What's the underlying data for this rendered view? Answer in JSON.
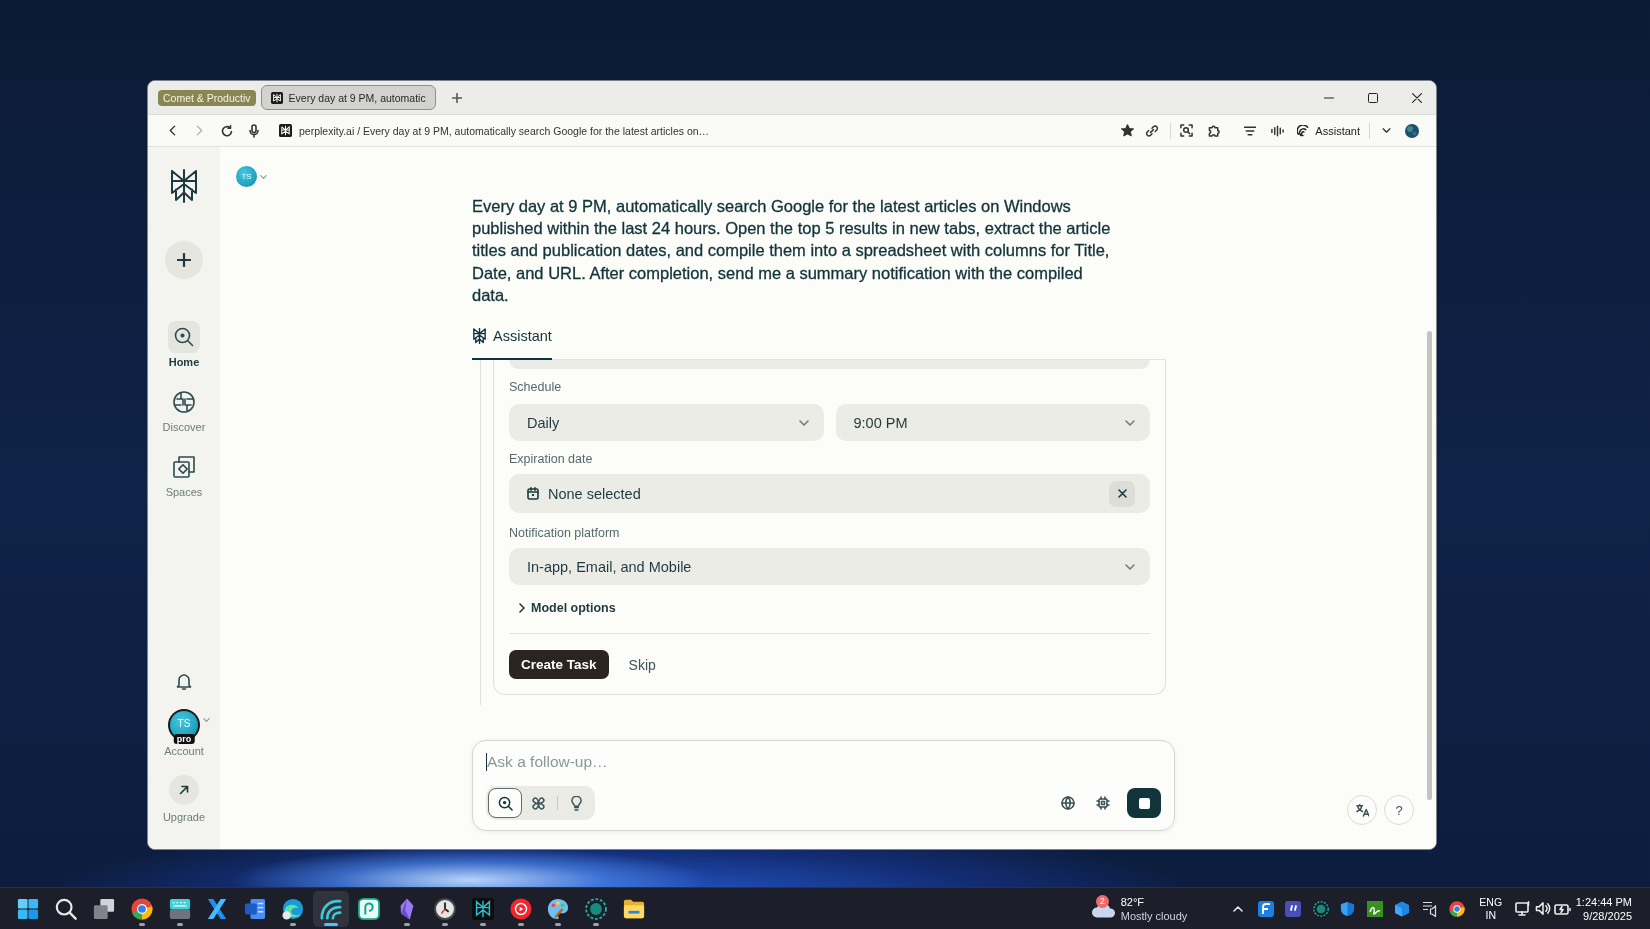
{
  "browser": {
    "tab_group": {
      "label": "Comet & Productiv"
    },
    "tabs": [
      {
        "title": "Every day at 9 PM, automatic",
        "selected": true
      }
    ],
    "address_bar": {
      "back_disabled": false,
      "forward_disabled": true,
      "url": "perplexity.ai / Every day at 9 PM, automatically search Google for the latest articles on…",
      "bookmarked": true,
      "assistant_label": "Assistant"
    }
  },
  "sidebar": {
    "nav": [
      {
        "label": "Home",
        "selected": true
      },
      {
        "label": "Discover",
        "selected": false
      },
      {
        "label": "Spaces",
        "selected": false
      }
    ],
    "account": {
      "initials": "TS",
      "badge": "pro",
      "label": "Account"
    },
    "upgrade": {
      "label": "Upgrade"
    }
  },
  "header": {
    "avatar_initials": "TS"
  },
  "query": "Every day at 9 PM, automatically search Google for the latest articles on Windows published within the last 24 hours. Open the top 5 results in new tabs, extract the article titles and publication dates, and compile them into a spreadsheet with columns for Title, Date, and URL. After completion, send me a summary notification with the compiled data.",
  "answer_tabs": [
    {
      "label": "Assistant",
      "selected": true
    }
  ],
  "task_form": {
    "schedule": {
      "label": "Schedule",
      "frequency": "Daily",
      "time": "9:00 PM"
    },
    "expiration": {
      "label": "Expiration date",
      "value": "None selected"
    },
    "notification": {
      "label": "Notification platform",
      "value": "In-app, Email, and Mobile"
    },
    "model_options": {
      "label": "Model options",
      "expanded": false
    },
    "buttons": [
      {
        "label": "Create Task",
        "kind": "primary"
      },
      {
        "label": "Skip",
        "kind": "text"
      }
    ]
  },
  "composer": {
    "placeholder": "Ask a follow-up…",
    "modes": [
      {
        "selected": true
      },
      {
        "selected": false
      },
      {
        "selected": false
      }
    ]
  },
  "help": {
    "label": "?"
  },
  "taskbar": {
    "apps": [
      {
        "running": false,
        "selected": false
      },
      {
        "running": false,
        "selected": false
      },
      {
        "running": false,
        "selected": false
      },
      {
        "running": true,
        "selected": false
      },
      {
        "running": true,
        "selected": false
      },
      {
        "running": false,
        "selected": false
      },
      {
        "running": false,
        "selected": false
      },
      {
        "running": true,
        "selected": false
      },
      {
        "running": true,
        "selected": true
      },
      {
        "running": false,
        "selected": false
      },
      {
        "running": true,
        "selected": false
      },
      {
        "running": true,
        "selected": false
      },
      {
        "running": true,
        "selected": false
      },
      {
        "running": true,
        "selected": false
      },
      {
        "running": true,
        "selected": false
      },
      {
        "running": true,
        "selected": false
      },
      {
        "running": false,
        "selected": false
      }
    ],
    "weather": {
      "badge": "2",
      "temperature": "82°F",
      "condition": "Mostly cloudy"
    },
    "language": {
      "code": "ENG",
      "region": "IN"
    },
    "clock": {
      "time": "1:24:44 PM",
      "date": "9/28/2025"
    }
  }
}
